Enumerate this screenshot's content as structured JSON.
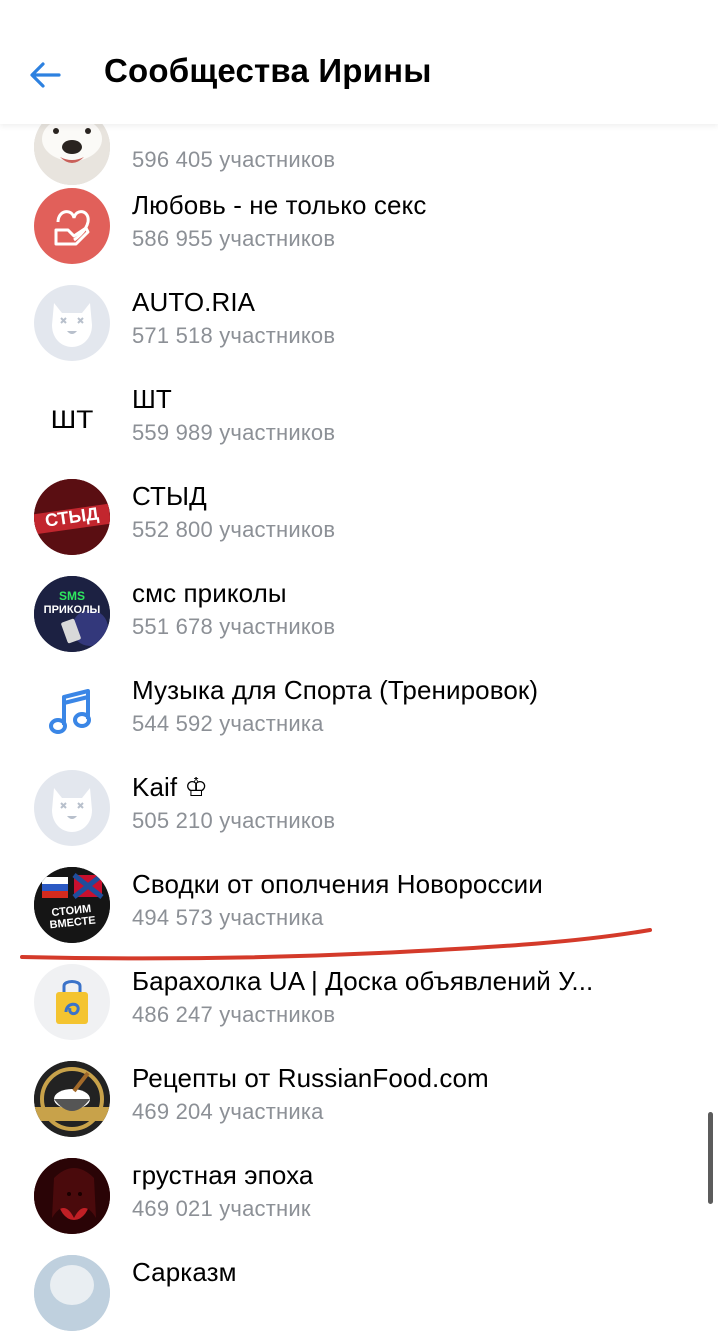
{
  "header": {
    "title": "Сообщества Ирины",
    "back_icon": "arrow-left-icon",
    "accent": "#2d81e0"
  },
  "communities": [
    {
      "name": "",
      "members": "596 405 участников",
      "icon": "dog-avatar"
    },
    {
      "name": "Любовь - не только секс",
      "members": "586 955 участников",
      "icon": "heart-hand-avatar"
    },
    {
      "name": "AUTO.RIA",
      "members": "571 518 участников",
      "icon": "default-dog-avatar"
    },
    {
      "name": "ШТ",
      "members": "559 989 участников",
      "icon": "sht-logo",
      "logo_text": "ШТ"
    },
    {
      "name": "СТЫД",
      "members": "552 800 участников",
      "icon": "styd-avatar",
      "logo_text": "СТЫД"
    },
    {
      "name": "смс приколы",
      "members": "551 678 участников",
      "icon": "sms-avatar",
      "logo_text": "ПРИКОЛЫ"
    },
    {
      "name": "Музыка для Спорта (Тренировок)",
      "members": "544 592 участника",
      "icon": "music-note-icon"
    },
    {
      "name": "Kaif ♔",
      "members": "505 210 участников",
      "icon": "default-dog-avatar"
    },
    {
      "name": "Сводки от ополчения Новороссии",
      "members": "494 573 участника",
      "icon": "flags-avatar",
      "logo_text": "СТОИМ ВМЕСТЕ"
    },
    {
      "name": "Барахолка UA | Доска объявлений У...",
      "members": "486 247 участников",
      "icon": "shopping-bag-icon"
    },
    {
      "name": "Рецепты от RussianFood.com",
      "members": "469 204 участника",
      "icon": "cooking-pot-avatar"
    },
    {
      "name": "грустная эпоха",
      "members": "469 021 участник",
      "icon": "red-portrait-avatar"
    },
    {
      "name": "Сарказм",
      "members": "",
      "icon": "portrait-avatar"
    }
  ],
  "colors": {
    "annotation_line": "#d43a2a",
    "secondary_text": "#8c9096"
  }
}
